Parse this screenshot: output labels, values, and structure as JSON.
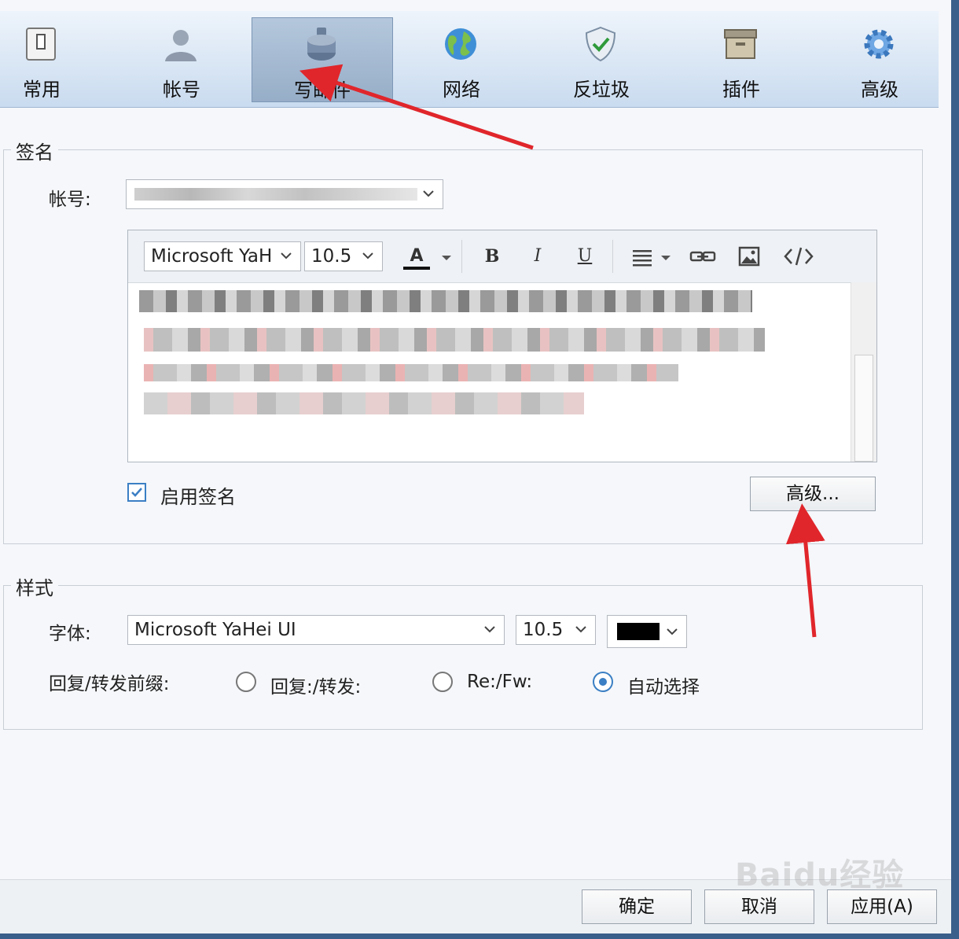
{
  "colors": {
    "accent": "#3b7fc4",
    "arrow": "#e0262b",
    "font_color_swatch": "#000000"
  },
  "tabs": [
    {
      "label": "常用",
      "icon": "general-icon"
    },
    {
      "label": "帐号",
      "icon": "user-icon"
    },
    {
      "label": "写邮件",
      "icon": "ink-bottle-icon",
      "active": true
    },
    {
      "label": "网络",
      "icon": "globe-icon"
    },
    {
      "label": "反垃圾",
      "icon": "shield-check-icon"
    },
    {
      "label": "插件",
      "icon": "box-icon"
    },
    {
      "label": "高级",
      "icon": "gear-icon"
    }
  ],
  "signature": {
    "legend": "签名",
    "account_label": "帐号:",
    "editor_toolbar": {
      "font": "Microsoft YaH",
      "size": "10.5",
      "font_color": "A",
      "bold": "B",
      "italic": "I",
      "underline": "U"
    },
    "enable_label": "启用签名",
    "enabled": true,
    "advanced_button": "高级..."
  },
  "style": {
    "legend": "样式",
    "font_label": "字体:",
    "font_value": "Microsoft YaHei UI",
    "size_value": "10.5",
    "prefix_label": "回复/转发前缀:",
    "options": [
      "回复:/转发:",
      "Re:/Fw:",
      "自动选择"
    ],
    "selected_option": "自动选择"
  },
  "footer": {
    "ok": "确定",
    "cancel": "取消",
    "apply": "应用(A)"
  },
  "watermark": "Baidu经验"
}
